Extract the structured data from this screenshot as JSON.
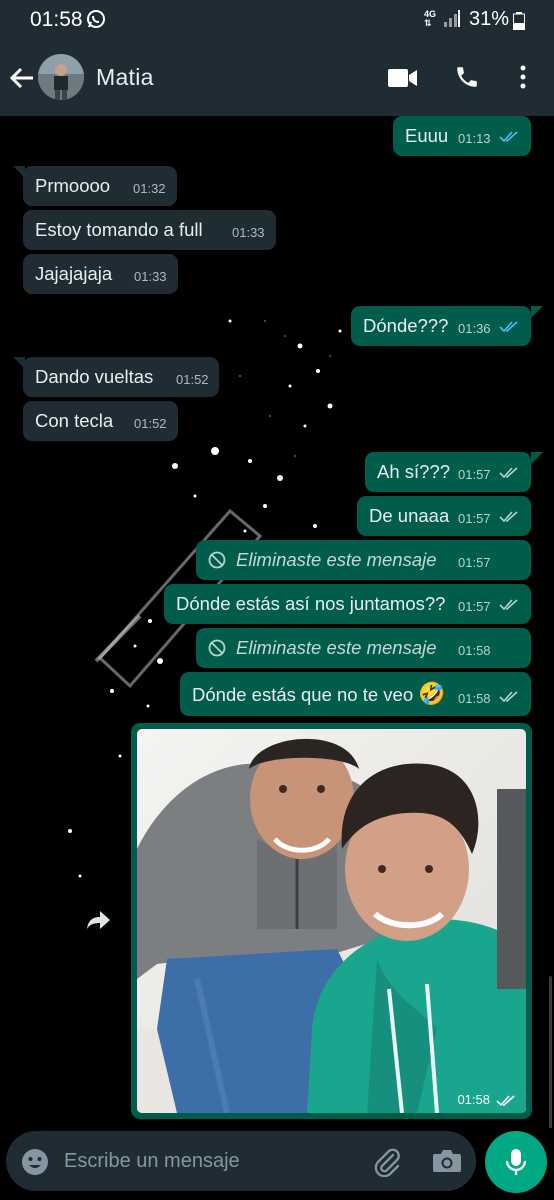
{
  "status_bar": {
    "time": "01:58",
    "network": "4G",
    "battery": "31%"
  },
  "header": {
    "contact_name": "Matia"
  },
  "messages": [
    {
      "text": "Euuu",
      "time": "01:13"
    },
    {
      "text": "Prmoooo",
      "time": "01:32"
    },
    {
      "text": "Estoy tomando a full",
      "time": "01:33"
    },
    {
      "text": "Jajajajaja",
      "time": "01:33"
    },
    {
      "text": "Dónde???",
      "time": "01:36"
    },
    {
      "text": "Dando vueltas",
      "time": "01:52"
    },
    {
      "text": "Con tecla",
      "time": "01:52"
    },
    {
      "text": "Ah sí???",
      "time": "01:57"
    },
    {
      "text": "De unaaa",
      "time": "01:57"
    },
    {
      "text": "Eliminaste este mensaje",
      "time": "01:57"
    },
    {
      "text": "Dónde estás así nos juntamos??",
      "time": "01:57"
    },
    {
      "text": "Eliminaste este mensaje",
      "time": "01:58"
    },
    {
      "text": "Dónde estás que no te veo",
      "emoji": "🤣",
      "time": "01:58"
    },
    {
      "type": "image",
      "time": "01:58"
    }
  ],
  "composer": {
    "placeholder": "Escribe un mensaje"
  },
  "colors": {
    "outgoing": "#005c4b",
    "incoming": "#1f2c34",
    "accent": "#00a884",
    "read_ticks": "#53bdeb",
    "header": "#1f2c34"
  },
  "icons": [
    "whatsapp-icon",
    "signal-icon",
    "battery-icon",
    "back-arrow-icon",
    "video-call-icon",
    "phone-icon",
    "more-menu-icon",
    "double-check-icon",
    "blocked-icon",
    "laughing-emoji-icon",
    "forward-icon",
    "emoji-icon",
    "attach-icon",
    "camera-icon",
    "mic-icon"
  ]
}
